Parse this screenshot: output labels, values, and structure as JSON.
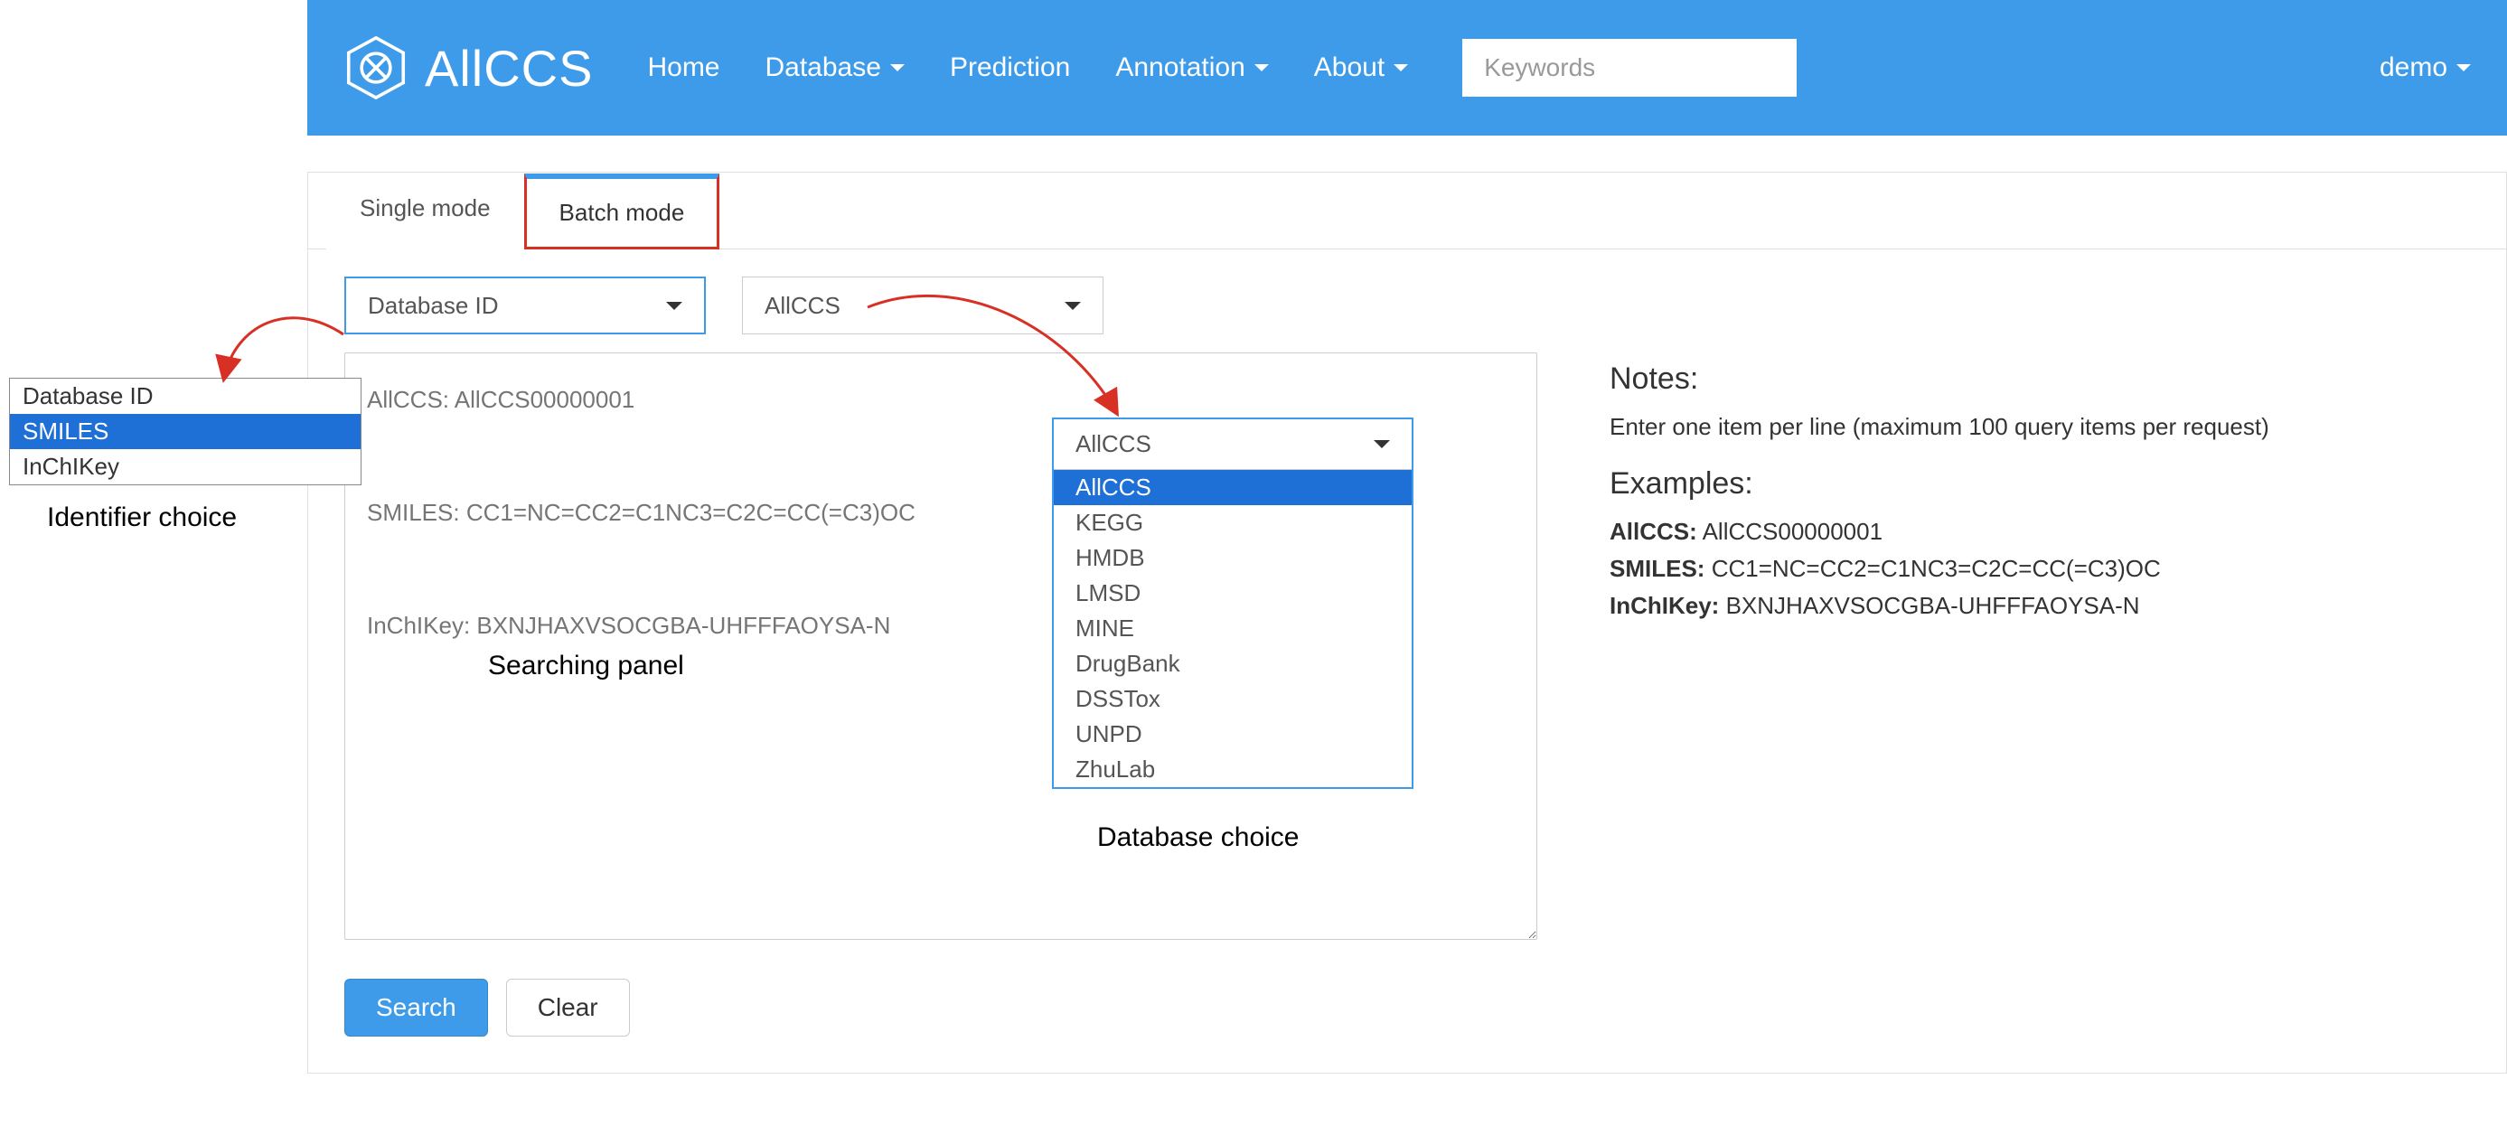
{
  "brand": {
    "name": "AllCCS"
  },
  "nav": {
    "items": [
      "Home",
      "Database",
      "Prediction",
      "Annotation",
      "About"
    ],
    "dropdown_flags": [
      false,
      true,
      false,
      true,
      true
    ],
    "search_placeholder": "Keywords",
    "user": "demo"
  },
  "tabs": {
    "single": "Single mode",
    "batch": "Batch mode",
    "active": "batch"
  },
  "identifier_select": {
    "value": "Database ID",
    "options": [
      "Database ID",
      "SMILES",
      "InChIKey"
    ],
    "highlighted": "SMILES"
  },
  "database_select": {
    "value": "AllCCS",
    "options": [
      "AllCCS",
      "KEGG",
      "HMDB",
      "LMSD",
      "MINE",
      "DrugBank",
      "DSSTox",
      "UNPD",
      "ZhuLab"
    ],
    "highlighted": "AllCCS"
  },
  "textarea_placeholder": "AllCCS: AllCCS00000001\n\nSMILES: CC1=NC=CC2=C1NC3=C2C=CC(=C3)OC\n\nInChIKey: BXNJHAXVSOCGBA-UHFFFAOYSA-N",
  "notes": {
    "title": "Notes:",
    "text": "Enter one item per line (maximum 100 query items per request)",
    "examples_title": "Examples:",
    "examples": [
      {
        "label": "AllCCS:",
        "value": "AllCCS00000001"
      },
      {
        "label": "SMILES:",
        "value": "CC1=NC=CC2=C1NC3=C2C=CC(=C3)OC"
      },
      {
        "label": "InChIKey:",
        "value": "BXNJHAXVSOCGBA-UHFFFAOYSA-N"
      }
    ]
  },
  "buttons": {
    "search": "Search",
    "clear": "Clear"
  },
  "annotations": {
    "identifier": "Identifier choice",
    "database": "Database choice",
    "searching": "Searching panel"
  }
}
